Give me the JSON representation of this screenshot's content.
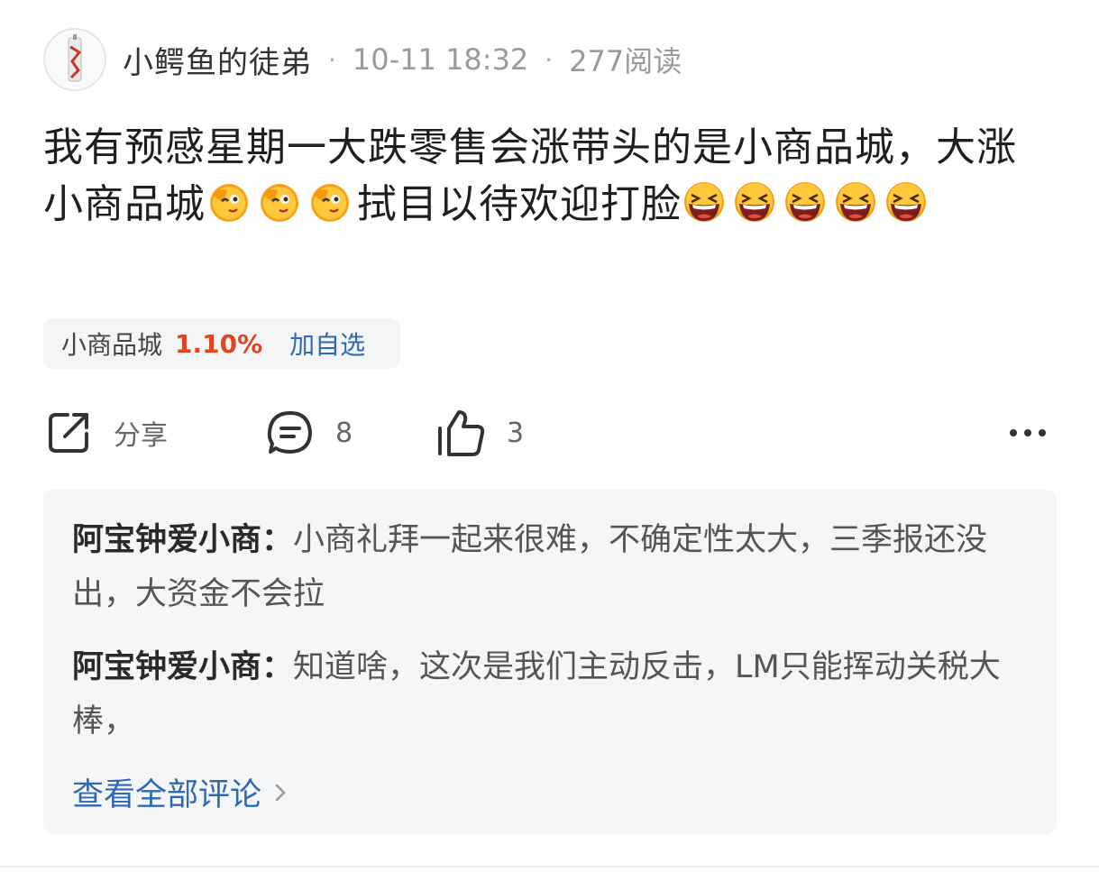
{
  "post": {
    "author": "小鳄鱼的徒弟",
    "datetime": "10-11 18:32",
    "reads": "277阅读",
    "text_part1": "我有预感星期一大跌零售会涨带头的是小商品城，大涨小商品城",
    "text_part2": "拭目以待欢迎打脸",
    "emoji_wink": "wink-face-emoji",
    "emoji_laugh": "laughing-face-emoji"
  },
  "stock": {
    "name": "小商品城",
    "change": "1.10%",
    "add_label": "加自选",
    "change_color": "#e0451f",
    "link_color": "#2f68b5"
  },
  "actions": {
    "share_label": "分享",
    "comment_count": "8",
    "like_count": "3",
    "icons": [
      "share-icon",
      "comment-icon",
      "thumbs-up-icon",
      "more-icon"
    ]
  },
  "comments": [
    {
      "name": "阿宝钟爱小商：",
      "text": "小商礼拜一起来很难，不确定性太大，三季报还没出，大资金不会拉"
    },
    {
      "name": "阿宝钟爱小商：",
      "text": "知道啥，这次是我们主动反击，LM只能挥动关税大棒，"
    }
  ],
  "view_all": "查看全部评论"
}
